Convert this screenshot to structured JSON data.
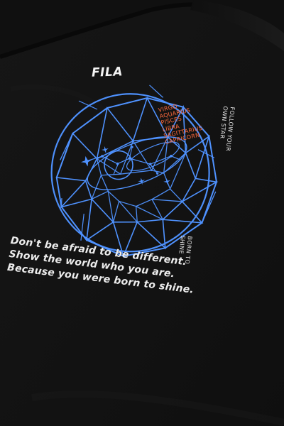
{
  "brand": {
    "logo_text": "FILA"
  },
  "artwork": {
    "primary_text": [
      "FOLLOW YOUR",
      "OWN STAR"
    ],
    "secondary_text": [
      "BORN TO",
      "SHINE"
    ],
    "zodiac_signs": [
      "VIRGO",
      "AQUARIUS",
      "PISCES",
      "LIBRA",
      "SAGITTARIUS",
      "CAPRICORN"
    ],
    "quote_lines": [
      "Don't be afraid to be different.",
      "Show the world who you are.",
      "Because you were born to shine."
    ]
  },
  "colors": {
    "shirt": "#151515",
    "accent_blue": "#4f92ff",
    "accent_orange": "#ff6a3d",
    "text": "#ececec"
  },
  "icons": {
    "brand_mark": "fila-logo",
    "graphic": "geodesic-globe-icon",
    "constellation": "constellation-icon"
  }
}
